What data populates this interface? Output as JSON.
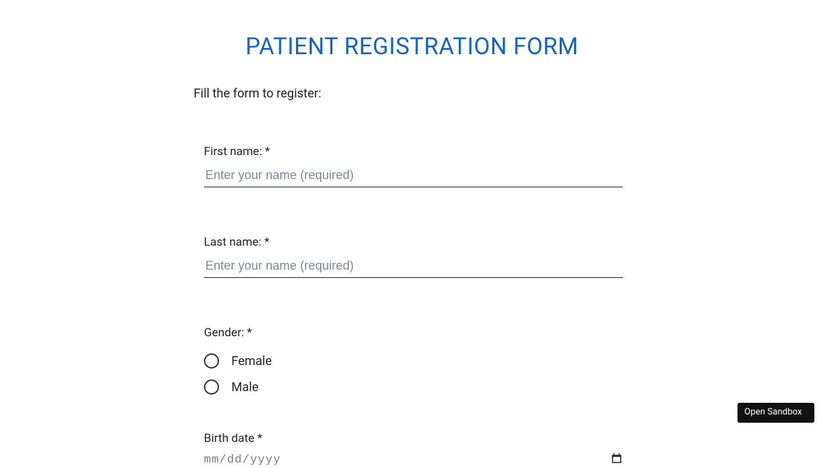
{
  "title": "PATIENT REGISTRATION FORM",
  "subtitle": "Fill the form to register:",
  "fields": {
    "first_name": {
      "label": "First name: *",
      "placeholder": "Enter your name (required)",
      "value": ""
    },
    "last_name": {
      "label": "Last name: *",
      "placeholder": "Enter your name (required)",
      "value": ""
    },
    "gender": {
      "label": "Gender: *",
      "options": [
        {
          "label": "Female",
          "value": "female"
        },
        {
          "label": "Male",
          "value": "male"
        }
      ]
    },
    "birth_date": {
      "label": "Birth date *",
      "placeholder": "mm/dd/yyyy"
    }
  },
  "sandbox_button": "Open Sandbox",
  "colors": {
    "title": "#1565c0",
    "text": "#222222",
    "placeholder": "#7e8a97"
  }
}
